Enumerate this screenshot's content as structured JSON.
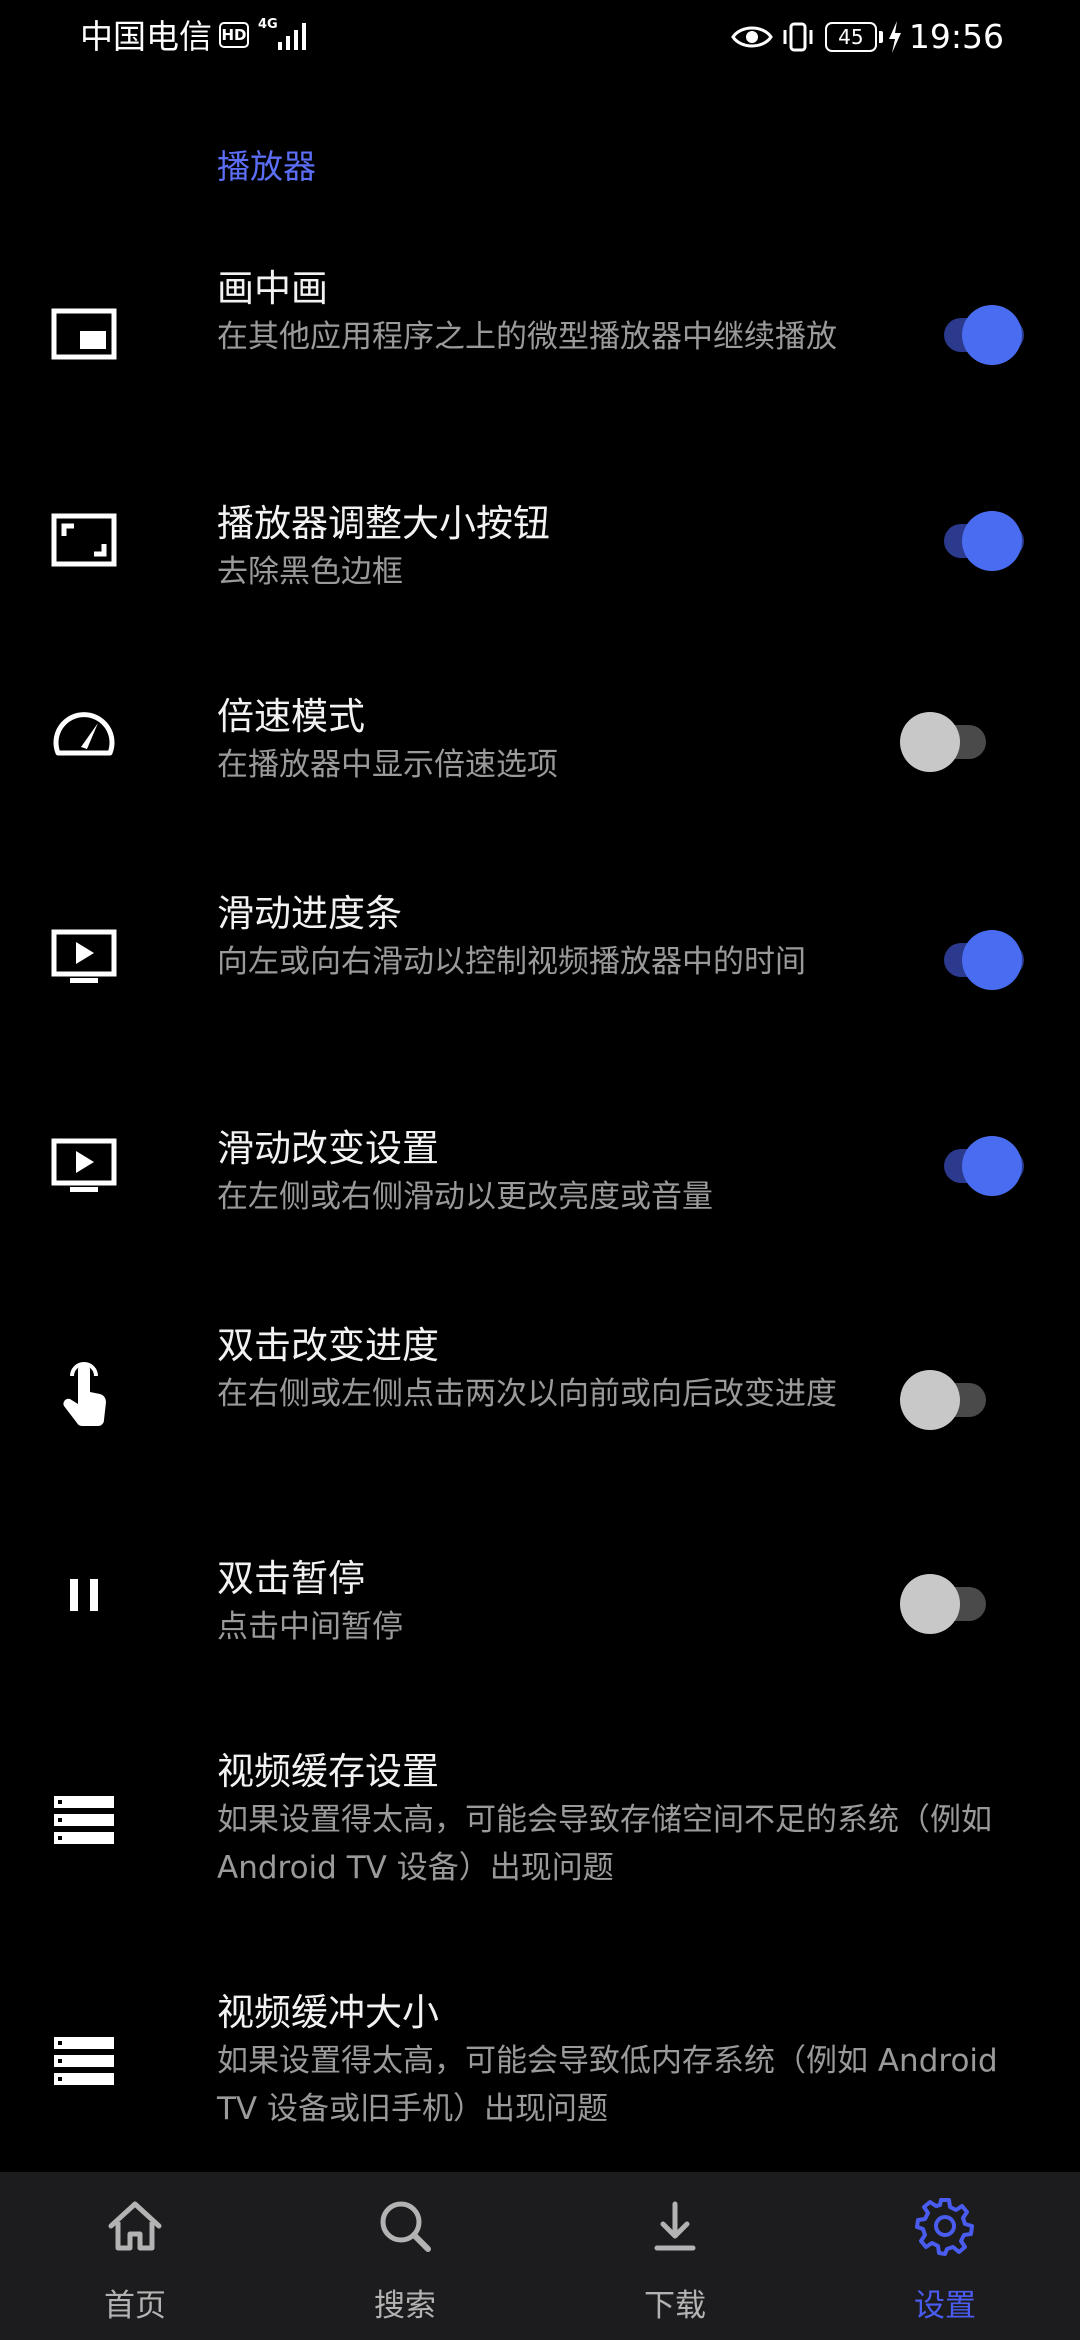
{
  "status_bar": {
    "carrier": "中国电信",
    "hd_badge": "HD",
    "network_type": "4G",
    "battery_level": "45",
    "time": "19:56"
  },
  "settings": {
    "section_title": "播放器",
    "items": [
      {
        "title": "画中画",
        "description": "在其他应用程序之上的微型播放器中继续播放",
        "icon": "picture-in-picture-icon",
        "enabled": true
      },
      {
        "title": "播放器调整大小按钮",
        "description": "去除黑色边框",
        "icon": "resize-frame-icon",
        "enabled": true
      },
      {
        "title": "倍速模式",
        "description": "在播放器中显示倍速选项",
        "icon": "speedometer-icon",
        "enabled": false
      },
      {
        "title": "滑动进度条",
        "description": "向左或向右滑动以控制视频播放器中的时间",
        "icon": "play-screen-icon",
        "enabled": true
      },
      {
        "title": "滑动改变设置",
        "description": "在左侧或右侧滑动以更改亮度或音量",
        "icon": "play-screen-icon",
        "enabled": true
      },
      {
        "title": "双击改变进度",
        "description": "在右侧或左侧点击两次以向前或向后改变进度",
        "icon": "tap-hand-icon",
        "enabled": false
      },
      {
        "title": "双击暂停",
        "description": "点击中间暂停",
        "icon": "pause-icon",
        "enabled": false
      },
      {
        "title": "视频缓存设置",
        "description": "如果设置得太高，可能会导致存储空间不足的系统（例如 Android TV 设备）出现问题",
        "icon": "storage-list-icon"
      },
      {
        "title": "视频缓冲大小",
        "description": "如果设置得太高，可能会导致低内存系统（例如 Android TV 设备或旧手机）出现问题",
        "icon": "storage-list-icon"
      }
    ]
  },
  "bottom_nav": {
    "items": [
      {
        "label": "首页",
        "icon": "home-icon",
        "active": false
      },
      {
        "label": "搜索",
        "icon": "search-icon",
        "active": false
      },
      {
        "label": "下载",
        "icon": "download-icon",
        "active": false
      },
      {
        "label": "设置",
        "icon": "gear-icon",
        "active": true
      }
    ]
  },
  "colors": {
    "background": "#000000",
    "accent": "#4a6cf0",
    "section_header": "#5b6ef5",
    "nav_background": "#1c1c1e"
  }
}
